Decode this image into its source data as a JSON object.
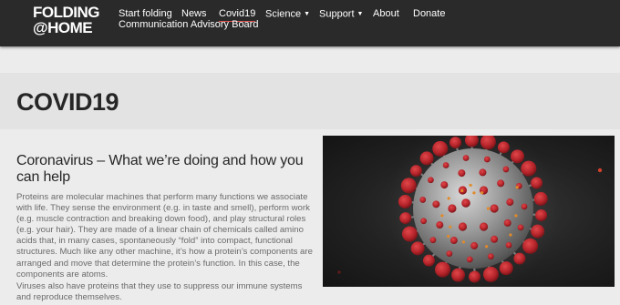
{
  "logo": {
    "line1": "FOLDING",
    "line2": "@HOME"
  },
  "nav": {
    "start_folding": "Start folding",
    "news": "News",
    "covid19": "Covid19",
    "science": "Science",
    "support": "Support",
    "about": "About",
    "donate": "Donate",
    "communication_advisory_board": "Communication Advisory Board",
    "caret": "▼"
  },
  "page": {
    "title": "COVID19"
  },
  "section": {
    "heading": "Coronavirus – What we’re doing and how you can help",
    "paragraph1": "Proteins are molecular machines that perform many functions we associate with life. They sense the environment (e.g. in taste and smell), perform work (e.g. muscle contraction and breaking down food), and play structural roles (e.g. your hair). They are made of a linear chain of chemicals called amino acids that, in many cases, spontaneously “fold” into compact, functional structures. Much like any other machine, it’s how a protein’s components are arranged and move that determine the protein’s function. In this case, the components are atoms.",
    "paragraph2": "Viruses also have proteins that they use to suppress our immune systems and reproduce themselves."
  },
  "colors": {
    "header_bg": "#2a2a2a",
    "page_bg": "#ececec",
    "active_underline": "#d9534f",
    "virus_spike": "#b5242a"
  }
}
